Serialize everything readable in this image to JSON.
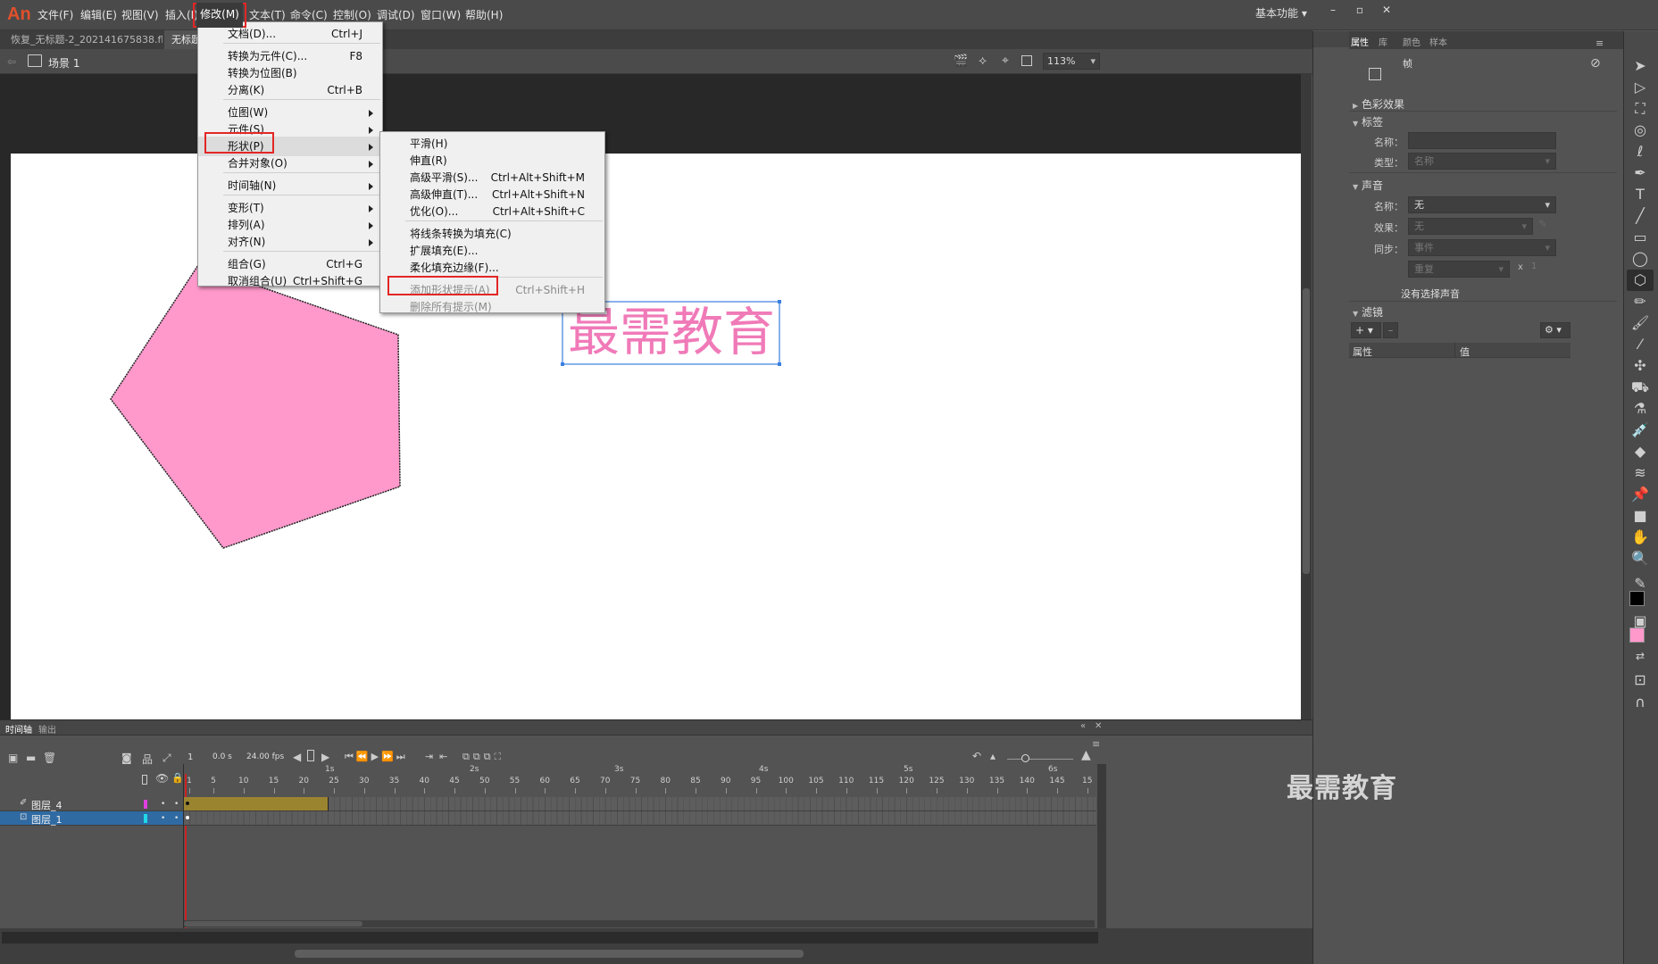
{
  "app": {
    "logo": "An",
    "workspace": "基本功能"
  },
  "menubar": [
    "文件(F)",
    "编辑(E)",
    "视图(V)",
    "插入(I)",
    "修改(M)",
    "文本(T)",
    "命令(C)",
    "控制(O)",
    "调试(D)",
    "窗口(W)",
    "帮助(H)"
  ],
  "doc_tabs": [
    "恢复_无标题-2_202141675838.fla*",
    "无标题"
  ],
  "scene": {
    "label": "场景 1",
    "zoom": "113%"
  },
  "stage": {
    "text": "最需教育",
    "pentagon_color": "#ff99cc",
    "text_color": "#f07ab8"
  },
  "modify_menu": [
    {
      "label": "文档(D)...",
      "shortcut": "Ctrl+J"
    },
    {
      "sep": true
    },
    {
      "label": "转换为元件(C)...",
      "shortcut": "F8"
    },
    {
      "label": "转换为位图(B)",
      "shortcut": ""
    },
    {
      "label": "分离(K)",
      "shortcut": "Ctrl+B"
    },
    {
      "sep": true
    },
    {
      "label": "位图(W)",
      "submenu": true
    },
    {
      "label": "元件(S)",
      "submenu": true
    },
    {
      "label": "形状(P)",
      "submenu": true,
      "active": true
    },
    {
      "label": "合并对象(O)",
      "submenu": true
    },
    {
      "sep": true
    },
    {
      "label": "时间轴(N)",
      "submenu": true
    },
    {
      "sep": true
    },
    {
      "label": "变形(T)",
      "submenu": true
    },
    {
      "label": "排列(A)",
      "submenu": true
    },
    {
      "label": "对齐(N)",
      "submenu": true
    },
    {
      "sep": true
    },
    {
      "label": "组合(G)",
      "shortcut": "Ctrl+G"
    },
    {
      "label": "取消组合(U)",
      "shortcut": "Ctrl+Shift+G"
    }
  ],
  "shape_submenu": [
    {
      "label": "平滑(H)",
      "shortcut": ""
    },
    {
      "label": "伸直(R)",
      "shortcut": ""
    },
    {
      "label": "高级平滑(S)...",
      "shortcut": "Ctrl+Alt+Shift+M"
    },
    {
      "label": "高级伸直(T)...",
      "shortcut": "Ctrl+Alt+Shift+N"
    },
    {
      "label": "优化(O)...",
      "shortcut": "Ctrl+Alt+Shift+C"
    },
    {
      "sep": true
    },
    {
      "label": "将线条转换为填充(C)",
      "shortcut": ""
    },
    {
      "label": "扩展填充(E)...",
      "shortcut": ""
    },
    {
      "label": "柔化填充边缘(F)...",
      "shortcut": ""
    },
    {
      "sep": true
    },
    {
      "label": "添加形状提示(A)",
      "shortcut": "Ctrl+Shift+H",
      "disabled": true
    },
    {
      "label": "删除所有提示(M)",
      "shortcut": "",
      "disabled": true
    }
  ],
  "timeline": {
    "tabs": [
      "时间轴",
      "输出"
    ],
    "current_frame": "1",
    "time": "0.0 s",
    "fps": "24.00 fps",
    "seconds": [
      "1s",
      "2s",
      "3s",
      "4s",
      "5s",
      "6s"
    ],
    "frame_numbers": [
      "1",
      "5",
      "10",
      "15",
      "20",
      "25",
      "30",
      "35",
      "40",
      "45",
      "50",
      "55",
      "60",
      "65",
      "70",
      "75",
      "80",
      "85",
      "90",
      "95",
      "100",
      "105",
      "110",
      "115",
      "120",
      "125",
      "130",
      "135",
      "140",
      "145",
      "15"
    ],
    "layers": [
      {
        "name": "图层_4",
        "color": "#e040e0",
        "selected": false,
        "tween_frames": 24
      },
      {
        "name": "图层_1",
        "color": "#20d8e8",
        "selected": true,
        "tween_frames": 0
      }
    ]
  },
  "panel": {
    "tabs": [
      "属性",
      "库",
      "颜色",
      "样本"
    ],
    "type_label": "帧",
    "sections": {
      "color_effect": "色彩效果",
      "label": "标签",
      "label_name": "名称：",
      "label_type": "类型：",
      "label_type_value": "名称",
      "sound": "声音",
      "sound_name": "名称：",
      "sound_name_value": "无",
      "sound_effect": "效果：",
      "sound_effect_value": "无",
      "sound_sync": "同步：",
      "sound_sync_value": "事件",
      "repeat_value": "重复",
      "repeat_x": "x",
      "repeat_count": "1",
      "no_sound": "没有选择声音",
      "filters": "滤镜",
      "filter_col_prop": "属性",
      "filter_col_value": "值"
    }
  },
  "watermark": "最需教育"
}
